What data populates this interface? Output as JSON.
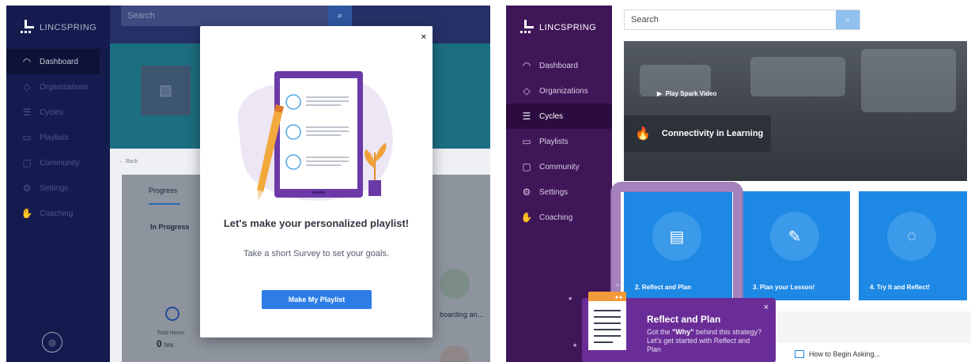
{
  "brand": {
    "name": "LINCSPRING",
    "name_prefix": "LINC",
    "name_suffix": "SPRING"
  },
  "left": {
    "search": {
      "placeholder": "Search"
    },
    "nav": [
      {
        "label": "Dashboard",
        "icon": "gauge-icon"
      },
      {
        "label": "Organizations",
        "icon": "graduation-cap-icon"
      },
      {
        "label": "Cycles",
        "icon": "list-icon"
      },
      {
        "label": "Playlists",
        "icon": "folder-icon"
      },
      {
        "label": "Community",
        "icon": "chat-icon"
      },
      {
        "label": "Settings",
        "icon": "gear-icon"
      },
      {
        "label": "Coaching",
        "icon": "hands-icon"
      }
    ],
    "back_label": "← Back",
    "tab_progress": "Progress",
    "in_progress": "In Progress",
    "total_hours_label": "Total Hours",
    "hours_value": "0",
    "hours_unit": "hrs",
    "onboarding_text": "boarding an...",
    "modal": {
      "close": "×",
      "title": "Let's make your personalized playlist!",
      "subtitle": "Take a short Survey to set your goals.",
      "button": "Make My Playlist"
    }
  },
  "right": {
    "search": {
      "placeholder": "Search"
    },
    "nav": [
      {
        "label": "Dashboard",
        "icon": "gauge-icon"
      },
      {
        "label": "Organizations",
        "icon": "graduation-cap-icon"
      },
      {
        "label": "Cycles",
        "icon": "list-icon"
      },
      {
        "label": "Playlists",
        "icon": "folder-icon"
      },
      {
        "label": "Community",
        "icon": "chat-icon"
      },
      {
        "label": "Settings",
        "icon": "gear-icon"
      },
      {
        "label": "Coaching",
        "icon": "hands-icon"
      }
    ],
    "video": {
      "play_label": "Play Spark Video",
      "topic": "Connectivity in Learning"
    },
    "cards": [
      {
        "label": "2. Reflect and Plan",
        "icon": "document-icon"
      },
      {
        "label": "3. Plan your Lesson!",
        "icon": "pencil-icon"
      },
      {
        "label": "4. Try It and Reflect!",
        "icon": "lightbulb-icon"
      }
    ],
    "tooltip": {
      "title": "Reflect and Plan",
      "text_before": "Got the ",
      "text_bold": "\"Why\"",
      "text_after": " behind this strategy? Let's get started with Reflect and Plan",
      "close": "×"
    },
    "lesson_item": "How to Begin Asking..."
  },
  "colors": {
    "left_sidebar": "#161b4f",
    "right_sidebar": "#3f1658",
    "accent_blue": "#1e88e5",
    "tooltip_purple": "#6a2d98"
  }
}
